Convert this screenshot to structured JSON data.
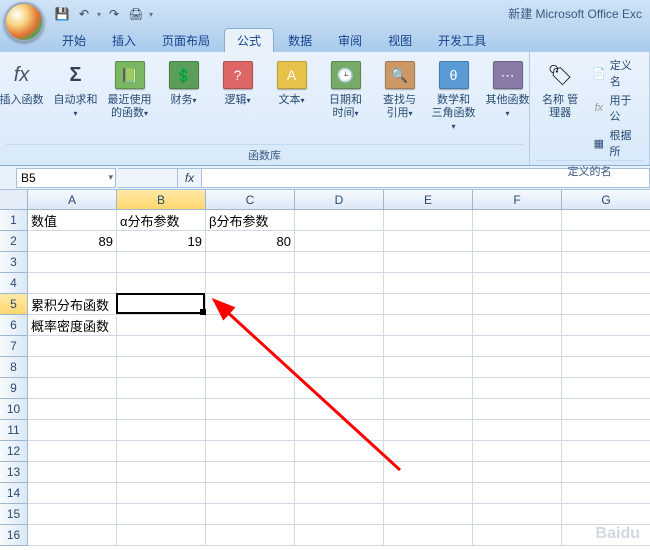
{
  "app": {
    "title": "新建 Microsoft Office Exc"
  },
  "qat": {
    "save": "💾",
    "undo": "↶",
    "redo": "↷",
    "print": "🖨",
    "dd": "▾"
  },
  "tabs": {
    "items": [
      {
        "label": "开始"
      },
      {
        "label": "插入"
      },
      {
        "label": "页面布局"
      },
      {
        "label": "公式"
      },
      {
        "label": "数据"
      },
      {
        "label": "审阅"
      },
      {
        "label": "视图"
      },
      {
        "label": "开发工具"
      }
    ],
    "active": 3
  },
  "ribbon": {
    "insert_fn": {
      "label": "插入函数",
      "icon": "fx"
    },
    "autosum": {
      "label": "自动求和",
      "icon": "Σ"
    },
    "recent": {
      "label": "最近使用\n的函数",
      "color": "#7bb661",
      "glyph": "📗"
    },
    "financial": {
      "label": "财务",
      "color": "#5a9e5a",
      "glyph": "💲"
    },
    "logical": {
      "label": "逻辑",
      "color": "#d66",
      "glyph": "?"
    },
    "text": {
      "label": "文本",
      "color": "#e6c24a",
      "glyph": "A"
    },
    "datetime": {
      "label": "日期和\n时间",
      "color": "#7a6",
      "glyph": "🕒"
    },
    "lookup": {
      "label": "查找与\n引用",
      "color": "#c96",
      "glyph": "🔍"
    },
    "math": {
      "label": "数学和\n三角函数",
      "color": "#5b9bd5",
      "glyph": "θ"
    },
    "more": {
      "label": "其他函数",
      "color": "#8a7aa8",
      "glyph": "⋯"
    },
    "group_label": "函数库",
    "name_mgr": {
      "label": "名称\n管理器",
      "glyph": "🏷"
    },
    "define_name": {
      "label": "定义名",
      "glyph": "📄"
    },
    "use_formula": {
      "label": "用于公",
      "glyph": "fx"
    },
    "create_selection": {
      "label": "根据所",
      "glyph": "▦"
    },
    "names_group_label": "定义的名"
  },
  "formula_bar": {
    "name_box": "B5",
    "fx": "fx",
    "value": ""
  },
  "grid": {
    "cols": [
      "A",
      "B",
      "C",
      "D",
      "E",
      "F",
      "G"
    ],
    "rows": 16,
    "selected": {
      "col": 1,
      "row": 4
    },
    "data": {
      "A1": "数值",
      "B1": "α分布参数",
      "C1": "β分布参数",
      "A2": "89",
      "B2": "19",
      "C2": "80",
      "A5": "累积分布函数",
      "A6": "概率密度函数"
    }
  },
  "watermark": {
    "brand": "Baidu",
    "sub": "",
    "url": ""
  }
}
